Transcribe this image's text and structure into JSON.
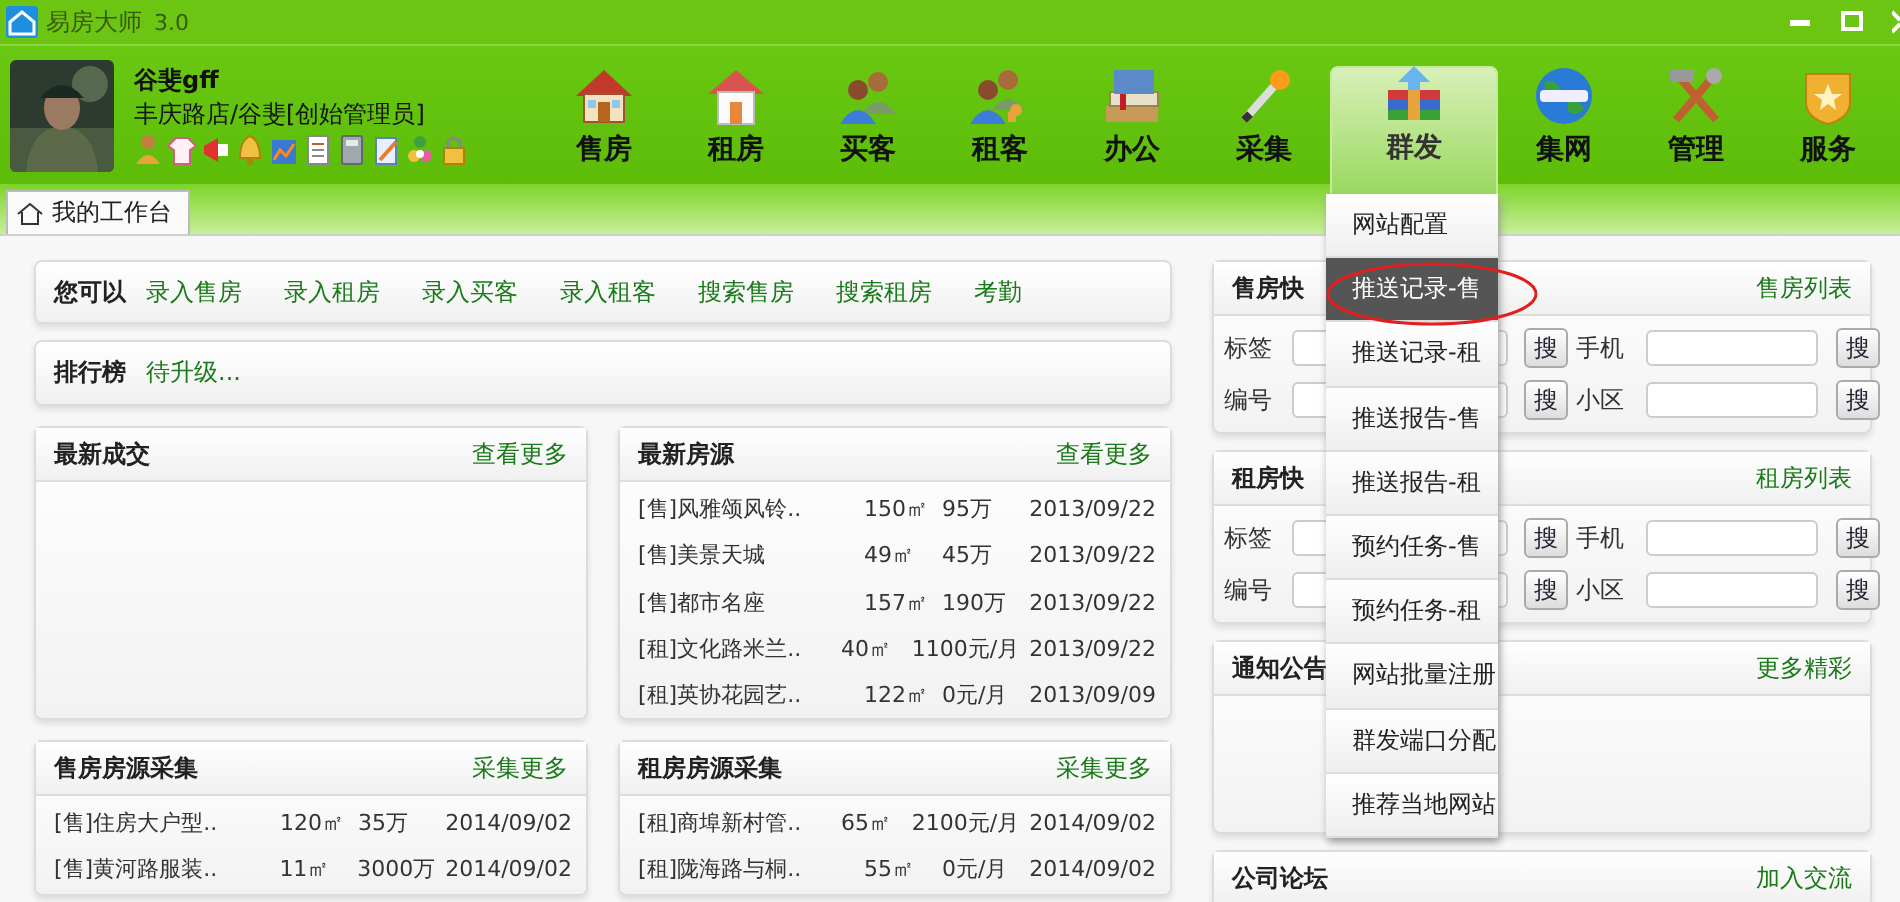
{
  "window": {
    "title": "易房大师",
    "version": "3.0"
  },
  "user": {
    "name": "谷斐gff",
    "role": "丰庆路店/谷斐[创始管理员]"
  },
  "nav": [
    {
      "label": "售房",
      "selected": false
    },
    {
      "label": "租房",
      "selected": false
    },
    {
      "label": "买客",
      "selected": false
    },
    {
      "label": "租客",
      "selected": false
    },
    {
      "label": "办公",
      "selected": false
    },
    {
      "label": "采集",
      "selected": false
    },
    {
      "label": "群发",
      "selected": true
    },
    {
      "label": "集网",
      "selected": false
    },
    {
      "label": "管理",
      "selected": false
    },
    {
      "label": "服务",
      "selected": false
    }
  ],
  "tabs": [
    {
      "label": "我的工作台",
      "selected": true
    }
  ],
  "quick_actions": {
    "label": "您可以",
    "links": [
      "录入售房",
      "录入租房",
      "录入买客",
      "录入租客",
      "搜索售房",
      "搜索租房",
      "考勤"
    ]
  },
  "ranking": {
    "label": "排行榜",
    "text": "待升级..."
  },
  "left_panels": [
    {
      "title": "最新成交",
      "more": "查看更多"
    },
    {
      "title": "最新房源",
      "more": "查看更多",
      "rows": [
        {
          "name": "[售]风雅颂风铃..",
          "area": "150㎡",
          "price": "95万",
          "date": "2013/09/22"
        },
        {
          "name": "[售]美景天城",
          "area": "49㎡",
          "price": "45万",
          "date": "2013/09/22"
        },
        {
          "name": "[售]都市名座",
          "area": "157㎡",
          "price": "190万",
          "date": "2013/09/22"
        },
        {
          "name": "[租]文化路米兰..",
          "area": "40㎡",
          "price": "1100元/月",
          "date": "2013/09/22"
        },
        {
          "name": "[租]英协花园艺..",
          "area": "122㎡",
          "price": "0元/月",
          "date": "2013/09/09"
        }
      ]
    },
    {
      "title": "售房房源采集",
      "more": "采集更多",
      "rows": [
        {
          "name": "[售]住房大户型..",
          "area": "120㎡",
          "price": "35万",
          "date": "2014/09/02"
        },
        {
          "name": "[售]黄河路服装..",
          "area": "11㎡",
          "price": "3000万",
          "date": "2014/09/02"
        }
      ]
    },
    {
      "title": "租房房源采集",
      "more": "采集更多",
      "rows": [
        {
          "name": "[租]商埠新村管..",
          "area": "65㎡",
          "price": "2100元/月",
          "date": "2014/09/02"
        },
        {
          "name": "[租]陇海路与桐..",
          "area": "55㎡",
          "price": "0元/月",
          "date": "2014/09/02"
        }
      ]
    }
  ],
  "right_panels": [
    {
      "kind": "search",
      "title": "售房快",
      "more": "售房列表",
      "fields": [
        {
          "label": "标签",
          "button": "搜"
        },
        {
          "label": "手机",
          "button": "搜"
        },
        {
          "label": "编号",
          "button": "搜"
        },
        {
          "label": "小区",
          "button": "搜"
        }
      ]
    },
    {
      "kind": "search",
      "title": "租房快",
      "more": "租房列表",
      "fields": [
        {
          "label": "标签",
          "button": "搜"
        },
        {
          "label": "手机",
          "button": "搜"
        },
        {
          "label": "编号",
          "button": "搜"
        },
        {
          "label": "小区",
          "button": "搜"
        }
      ]
    },
    {
      "kind": "notice",
      "title": "通知公告",
      "more": "更多精彩"
    },
    {
      "kind": "forum",
      "title": "公司论坛",
      "more": "加入交流"
    }
  ],
  "dropdown": {
    "items": [
      {
        "label": "网站配置",
        "selected": false
      },
      {
        "label": "推送记录-售",
        "selected": true
      },
      {
        "label": "推送记录-租",
        "selected": false
      },
      {
        "label": "推送报告-售",
        "selected": false
      },
      {
        "label": "推送报告-租",
        "selected": false
      },
      {
        "label": "预约任务-售",
        "selected": false
      },
      {
        "label": "预约任务-租",
        "selected": false
      },
      {
        "label": "网站批量注册",
        "selected": false
      },
      {
        "label": "群发端口分配",
        "selected": false
      },
      {
        "label": "推荐当地网站",
        "selected": false
      }
    ]
  }
}
